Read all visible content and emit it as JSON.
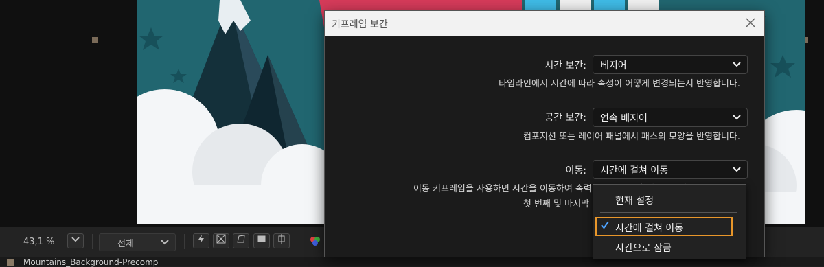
{
  "viewer": {
    "zoom": "43,1 %",
    "resolution": "전체"
  },
  "panel": {
    "tab_label": "Mountains_Background-Precomp"
  },
  "dialog": {
    "title": "키프레임 보간",
    "rows": [
      {
        "label": "시간 보간:",
        "value": "베지어",
        "description": "타임라인에서 시간에 따라 속성이 어떻게 변경되는지 반영합니다."
      },
      {
        "label": "공간 보간:",
        "value": "연속 베지어",
        "description": "컴포지션 또는 레이어 패널에서 패스의 모양을 반영합니다."
      },
      {
        "label": "이동:",
        "value": "시간에 걸쳐 이동",
        "description": "이동 키프레임을 사용하면 시간을 이동하여 속력 그래프를 원활하게 조정할 수 있습니다.",
        "description2": "첫 번째 및 마지막"
      }
    ]
  },
  "dropdown": {
    "items": [
      "현재 설정",
      "시간에 걸쳐 이동",
      "시간으로 잠금"
    ],
    "selected_index": 1
  },
  "colors": {
    "accent_highlight": "#e8962a",
    "check_blue": "#4ea3ff"
  }
}
